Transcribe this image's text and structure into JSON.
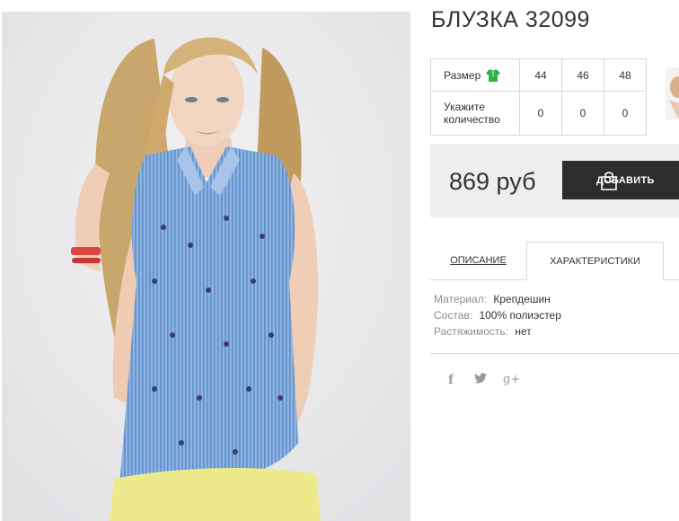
{
  "product": {
    "title": "БЛУЗКА 32099",
    "photo_alt": "model in sleeveless blue striped blouse",
    "price": "869 руб",
    "add_to_cart_label": "ДОБАВИТЬ"
  },
  "sizes": {
    "size_label": "Размер",
    "quantity_label_line1": "Укажите",
    "quantity_label_line2": "количество",
    "options": [
      "44",
      "46",
      "48"
    ],
    "quantities": [
      "0",
      "0",
      "0"
    ],
    "icon": "shirt-icon",
    "icon_color": "#2bb34a"
  },
  "tabs": [
    {
      "label": "ОПИСАНИЕ",
      "active": false
    },
    {
      "label": "ХАРАКТЕРИСТИКИ",
      "active": true
    }
  ],
  "specs": [
    {
      "label": "Материал:",
      "value": "Крепдешин"
    },
    {
      "label": "Состав:",
      "value": "100% полиэстер"
    },
    {
      "label": "Растяжимость:",
      "value": "нет"
    }
  ],
  "social": [
    {
      "name": "facebook-icon",
      "glyph": "f"
    },
    {
      "name": "twitter-icon",
      "glyph": "🐦"
    },
    {
      "name": "google-plus-icon",
      "glyph": "g+"
    }
  ],
  "colors": {
    "button_bg": "#2d2d2d",
    "price_bar_bg": "#eeeeee",
    "blouse_blue": "#7aa3d6",
    "pants_yellow": "#eee98a"
  }
}
